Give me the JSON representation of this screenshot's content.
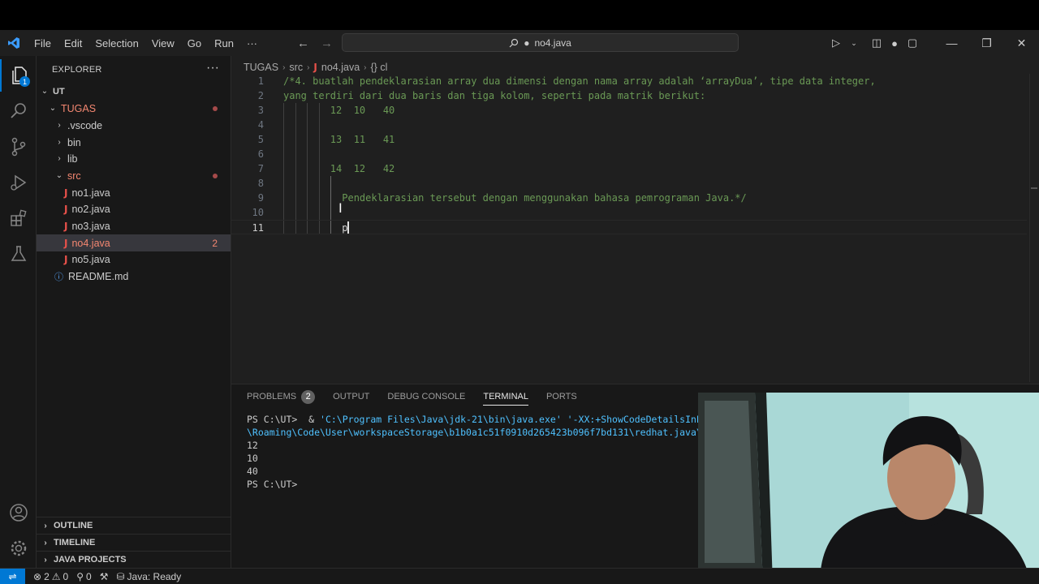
{
  "titlebar": {
    "menu": [
      "File",
      "Edit",
      "Selection",
      "View",
      "Go",
      "Run",
      "···"
    ],
    "search_text": "no4.java"
  },
  "explorer": {
    "title": "EXPLORER",
    "root": "UT",
    "folder": "TUGAS",
    "items": [
      {
        "label": ".vscode"
      },
      {
        "label": "bin"
      },
      {
        "label": "lib"
      }
    ],
    "src_folder": "src",
    "files": [
      "no1.java",
      "no2.java",
      "no3.java",
      "no4.java",
      "no5.java"
    ],
    "selected_count": "2",
    "readme": "README.md",
    "sections": [
      "OUTLINE",
      "TIMELINE",
      "JAVA PROJECTS"
    ]
  },
  "breadcrumb": [
    "TUGAS",
    "src",
    "no4.java",
    "{} cl"
  ],
  "editor": {
    "lines": [
      {
        "n": "1",
        "text": "/*4. buatlah pendeklarasian array dua dimensi dengan nama array adalah ‘arrayDua’, tipe data integer,"
      },
      {
        "n": "2",
        "text": "yang terdiri dari dua baris dan tiga kolom, seperti pada matrik berikut:"
      },
      {
        "n": "3",
        "text": "        12  10   40"
      },
      {
        "n": "4",
        "text": ""
      },
      {
        "n": "5",
        "text": "        13  11   41"
      },
      {
        "n": "6",
        "text": ""
      },
      {
        "n": "7",
        "text": "        14  12   42"
      },
      {
        "n": "8",
        "text": ""
      },
      {
        "n": "9",
        "text": "          Pendeklarasian tersebut dengan menggunakan bahasa pemrograman Java.*/"
      },
      {
        "n": "10",
        "text": ""
      },
      {
        "n": "11",
        "text": "          p"
      }
    ]
  },
  "panel": {
    "tabs": [
      "PROBLEMS",
      "OUTPUT",
      "DEBUG CONSOLE",
      "TERMINAL",
      "PORTS"
    ],
    "problems_count": "2",
    "terminal": {
      "prompt1": "PS C:\\UT> ",
      "cmd_amp": " & ",
      "cmd_exe": "'C:\\Program Files\\Java\\jdk-21\\bin\\java.exe'",
      "cmd_arg": " '-XX:+ShowCodeDetailsInExcep",
      "line2": "\\Roaming\\Code\\User\\workspaceStorage\\b1b0a1c51f0910d265423b096f7bd131\\redhat.java\\jdt_",
      "out": [
        "12",
        "10",
        "40"
      ],
      "prompt2": "PS C:\\UT>"
    }
  },
  "statusbar": {
    "errors": "2",
    "warnings": "0",
    "info": "0",
    "java": "Java: Ready"
  },
  "colors": {
    "accent": "#0078d4",
    "comment": "#6a9955",
    "error": "#f48771"
  }
}
